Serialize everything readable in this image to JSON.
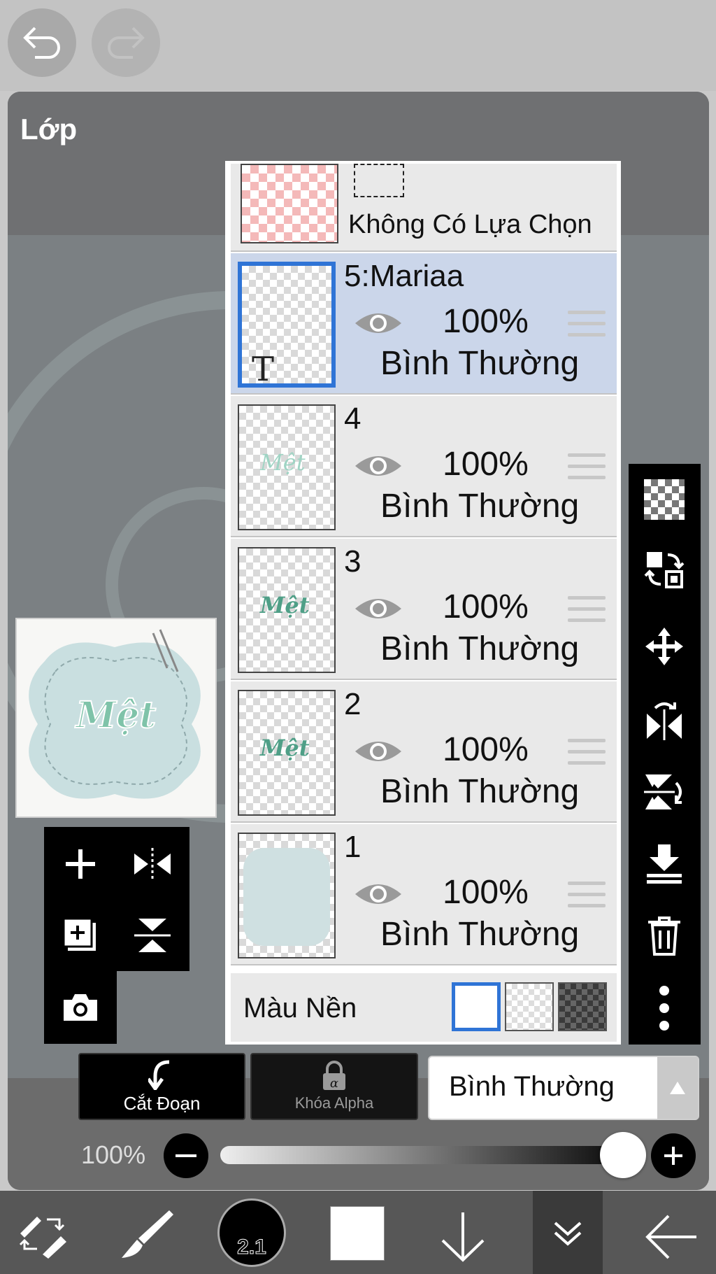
{
  "top": {
    "undo_icon": "undo-icon",
    "redo_icon": "redo-icon"
  },
  "panel": {
    "title": "Lớp"
  },
  "selection_layer": {
    "label": "Không Có Lựa Chọn"
  },
  "layers": [
    {
      "name": "5:Mariaa",
      "opacity": "100%",
      "blend": "Bình Thường",
      "selected": true,
      "thumb_text": "T"
    },
    {
      "name": "4",
      "opacity": "100%",
      "blend": "Bình Thường",
      "selected": false
    },
    {
      "name": "3",
      "opacity": "100%",
      "blend": "Bình Thường",
      "selected": false
    },
    {
      "name": "2",
      "opacity": "100%",
      "blend": "Bình Thường",
      "selected": false
    },
    {
      "name": "1",
      "opacity": "100%",
      "blend": "Bình Thường",
      "selected": false
    }
  ],
  "background": {
    "label": "Màu Nền"
  },
  "preview": {
    "word": "Mệt"
  },
  "buttons": {
    "clip": "Cắt Đoạn",
    "alpha": "Khóa Alpha"
  },
  "blend_mode": {
    "value": "Bình Thường"
  },
  "opacity_slider": {
    "label": "100%",
    "value": 1.0
  },
  "brush": {
    "size": "2.1"
  },
  "colors": {
    "accent": "#2f74d6",
    "selected_row": "#cbd6ea",
    "swatch": "#ffffff"
  }
}
